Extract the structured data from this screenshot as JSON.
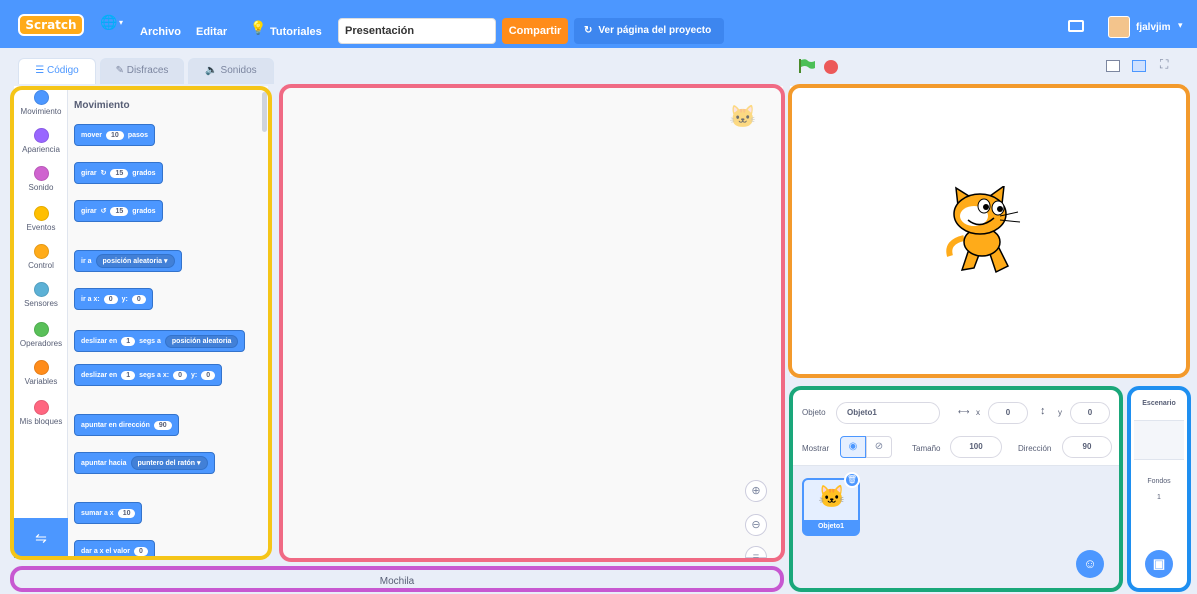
{
  "menubar": {
    "logo": "Scratch",
    "language_icon": "globe-icon",
    "file": "Archivo",
    "edit": "Editar",
    "tutorials": "Tutoriales",
    "project_title": "Presentación",
    "share": "Compartir",
    "see_project": "Ver página del proyecto",
    "username": "fjalvjim"
  },
  "tabs": {
    "code": "Código",
    "costumes": "Disfraces",
    "sounds": "Sonidos"
  },
  "categories": [
    {
      "label": "Movimiento",
      "color": "#4c97ff"
    },
    {
      "label": "Apariencia",
      "color": "#9966ff"
    },
    {
      "label": "Sonido",
      "color": "#cf63cf"
    },
    {
      "label": "Eventos",
      "color": "#ffbf00"
    },
    {
      "label": "Control",
      "color": "#ffab19"
    },
    {
      "label": "Sensores",
      "color": "#5cb1d6"
    },
    {
      "label": "Operadores",
      "color": "#59c059"
    },
    {
      "label": "Variables",
      "color": "#ff8c1a"
    },
    {
      "label": "Mis bloques",
      "color": "#ff6680"
    }
  ],
  "palette": {
    "heading": "Movimiento",
    "b1": {
      "a": "mover",
      "v": "10",
      "b": "pasos"
    },
    "b2": {
      "a": "girar",
      "v": "15",
      "b": "grados"
    },
    "b3": {
      "a": "girar",
      "v": "15",
      "b": "grados"
    },
    "b4": {
      "a": "ir a",
      "d": "posición aleatoria ▾"
    },
    "b5": {
      "a": "ir a x:",
      "v": "0",
      "b": "y:",
      "w": "0"
    },
    "b6": {
      "a": "deslizar en",
      "v": "1",
      "b": "segs a",
      "d": "posición aleatoria"
    },
    "b7": {
      "a": "deslizar en",
      "v": "1",
      "b": "segs a x:",
      "w": "0",
      "c": "y:",
      "u": "0"
    },
    "b8": {
      "a": "apuntar en dirección",
      "v": "90"
    },
    "b9": {
      "a": "apuntar hacia",
      "d": "puntero del ratón ▾"
    },
    "b10": {
      "a": "sumar a x",
      "v": "10"
    },
    "b11": {
      "a": "dar a x el valor",
      "v": "0"
    }
  },
  "backpack": "Mochila",
  "sprite_info": {
    "sprite_label": "Objeto",
    "sprite_name": "Objeto1",
    "x_label": "x",
    "x": "0",
    "y_label": "y",
    "y": "0",
    "show_label": "Mostrar",
    "size_label": "Tamaño",
    "size": "100",
    "direction_label": "Dirección",
    "direction": "90"
  },
  "sprite_list": {
    "sprite1": "Objeto1"
  },
  "stage_panel": {
    "title": "Escenario",
    "backdrops_label": "Fondos",
    "backdrops_count": "1"
  },
  "colors": {
    "menubar": "#4c97ff",
    "share": "#ff8c1a",
    "frame_palette": "#f5c518",
    "frame_scripts": "#f06a84",
    "frame_stage": "#f39a2c",
    "frame_sprite": "#1aa77a",
    "frame_backdrop": "#1e8ff0",
    "frame_backpack": "#c758d1"
  }
}
